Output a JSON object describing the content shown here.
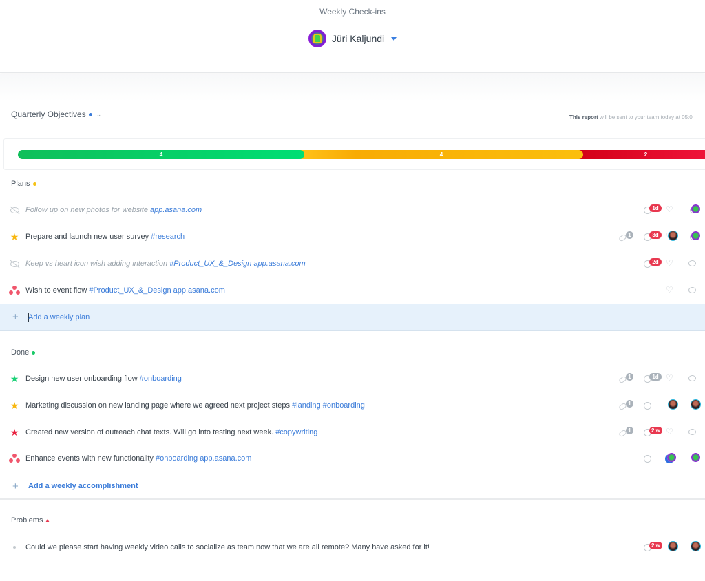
{
  "topbar": {
    "title": "Weekly Check-ins"
  },
  "user": {
    "name": "Jüri Kaljundi",
    "avatar": "green-figure-avatar"
  },
  "objectives": {
    "title": "Quarterly Objectives",
    "dot_color": "#3b7cd9",
    "report_note_bold": "This report",
    "report_note_rest": " will be sent to your team today at 05:0",
    "progress": [
      {
        "status": "on-track",
        "count": "4",
        "color": "#00d36a"
      },
      {
        "status": "at-risk",
        "count": "4",
        "color": "#fbb80a"
      },
      {
        "status": "off-track",
        "count": "2",
        "color": "#e5102f"
      }
    ]
  },
  "plans": {
    "title": "Plans",
    "dot_color": "#f5c216",
    "items": [
      {
        "icon": "eye-off-icon",
        "muted": true,
        "text": "Follow up on new photos for website ",
        "tags": [],
        "link": "app.asana.com",
        "meta": {
          "due": "1d",
          "heart": true,
          "assignee": "green"
        }
      },
      {
        "icon": "star-icon",
        "star_color": "#f8b70f",
        "muted": false,
        "text": "Prepare and launch new user survey ",
        "tags": [
          "#research"
        ],
        "link": "",
        "meta": {
          "links": "1",
          "due": "3d",
          "liker": "photo",
          "assignee": "green"
        }
      },
      {
        "icon": "eye-off-icon",
        "muted": true,
        "text": "Keep vs heart icon wish adding interaction ",
        "tags": [
          "#Product_UX_&_Design"
        ],
        "link": "app.asana.com",
        "meta": {
          "due": "2d",
          "heart": true,
          "comment": true
        }
      },
      {
        "icon": "asana-icon",
        "muted": false,
        "text": "Wish to event flow ",
        "tags": [
          "#Product_UX_&_Design"
        ],
        "link": "app.asana.com",
        "meta": {
          "heart": true,
          "comment": true
        }
      }
    ],
    "add_label": "Add a weekly plan"
  },
  "done": {
    "title": "Done",
    "dot_color": "#1bc968",
    "items": [
      {
        "icon": "star-icon",
        "star_color": "#1bd177",
        "text": "Design new user onboarding flow ",
        "tags": [
          "#onboarding"
        ],
        "link": "",
        "meta": {
          "links": "1",
          "due_gray": "1d",
          "heart": true,
          "comment": true
        }
      },
      {
        "icon": "star-icon",
        "star_color": "#f8b70f",
        "text": "Marketing discussion on new landing page where we agreed next project steps ",
        "tags": [
          "#landing",
          "#onboarding"
        ],
        "link": "",
        "meta": {
          "links": "1",
          "clock": true,
          "liker": "photo",
          "assignee": "photo"
        }
      },
      {
        "icon": "star-icon",
        "star_color": "#e8213f",
        "text": "Created new version of outreach chat texts. Will go into testing next week. ",
        "tags": [
          "#copywriting"
        ],
        "link": "",
        "meta": {
          "links": "1",
          "due": "2 w",
          "heart": true,
          "comment": true
        }
      },
      {
        "icon": "asana-icon",
        "text": "Enhance events with new functionality ",
        "tags": [
          "#onboarding"
        ],
        "link": "app.asana.com",
        "meta": {
          "clock": true,
          "liker": "green",
          "assignee": "green"
        }
      }
    ],
    "add_label": "Add a weekly accomplishment"
  },
  "problems": {
    "title": "Problems",
    "items": [
      {
        "text": "Could we please start having weekly video calls to socialize as team now that we are all remote? Many have asked for it!",
        "meta": {
          "due": "2 w",
          "liker": "photo",
          "assignee": "photo"
        }
      }
    ]
  }
}
